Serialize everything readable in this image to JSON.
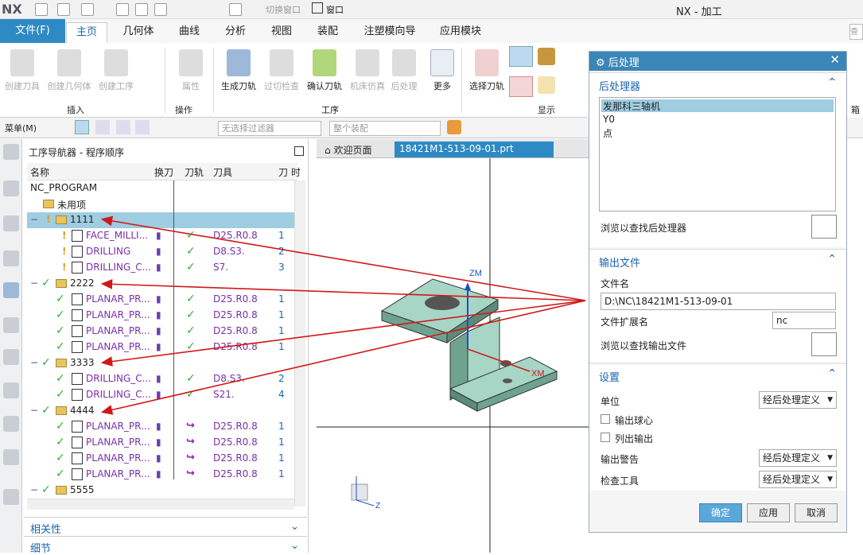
{
  "titlebar": {
    "logo": "NX",
    "title": "NX - 加工",
    "switch_window": "切换窗口",
    "window": "窗口"
  },
  "tabs": [
    "文件(F)",
    "主页",
    "几何体",
    "曲线",
    "分析",
    "视图",
    "装配",
    "注塑模向导",
    "应用模块"
  ],
  "search_hint": "查",
  "ribbon": {
    "buttons": [
      "创建刀具",
      "创建几何体",
      "创建工序",
      "属性",
      "生成刀轨",
      "过切检查",
      "确认刀轨",
      "机床仿真",
      "后处理",
      "更多",
      "选择刀轨"
    ],
    "groups": [
      "插入",
      "操作",
      "工序",
      "显示"
    ],
    "extra": "箱"
  },
  "toolbar": {
    "menu": "菜单(M)",
    "filter_placeholder": "无选择过滤器",
    "assembly_placeholder": "整个装配"
  },
  "navigator": {
    "title": "工序导航器 - 程序顺序",
    "headers": [
      "名称",
      "换刀",
      "刀轨",
      "刀具",
      "刀",
      "时"
    ],
    "root": "NC_PROGRAM",
    "unused": "未用项",
    "rows": [
      {
        "name": "1111",
        "type": "group",
        "tool": "",
        "num": ""
      },
      {
        "name": "FACE_MILLI...",
        "type": "op",
        "tool": "D25.R0.8",
        "num": "1"
      },
      {
        "name": "DRILLING",
        "type": "op",
        "tool": "D8.S3.",
        "num": "2"
      },
      {
        "name": "DRILLING_C...",
        "type": "op",
        "tool": "S7.",
        "num": "3"
      },
      {
        "name": "2222",
        "type": "group",
        "tool": "",
        "num": ""
      },
      {
        "name": "PLANAR_PR...",
        "type": "op",
        "tool": "D25.R0.8",
        "num": "1"
      },
      {
        "name": "PLANAR_PR...",
        "type": "op",
        "tool": "D25.R0.8",
        "num": "1"
      },
      {
        "name": "PLANAR_PR...",
        "type": "op",
        "tool": "D25.R0.8",
        "num": "1"
      },
      {
        "name": "PLANAR_PR...",
        "type": "op",
        "tool": "D25.R0.8",
        "num": "1"
      },
      {
        "name": "3333",
        "type": "group",
        "tool": "",
        "num": ""
      },
      {
        "name": "DRILLING_C...",
        "type": "op",
        "tool": "D8.S3.",
        "num": "2"
      },
      {
        "name": "DRILLING_C...",
        "type": "op",
        "tool": "S21.",
        "num": "4"
      },
      {
        "name": "4444",
        "type": "group",
        "tool": "",
        "num": ""
      },
      {
        "name": "PLANAR_PR...",
        "type": "op",
        "tool": "D25.R0.8",
        "num": "1"
      },
      {
        "name": "PLANAR_PR...",
        "type": "op",
        "tool": "D25.R0.8",
        "num": "1"
      },
      {
        "name": "PLANAR_PR...",
        "type": "op",
        "tool": "D25.R0.8",
        "num": "1"
      },
      {
        "name": "PLANAR_PR...",
        "type": "op",
        "tool": "D25.R0.8",
        "num": "1"
      },
      {
        "name": "5555",
        "type": "group",
        "tool": "",
        "num": ""
      }
    ],
    "sections": [
      "相关性",
      "细节"
    ]
  },
  "viewport": {
    "tabs": [
      "欢迎页面",
      "18421M1-513-09-01.prt"
    ],
    "axis_zm": "ZM",
    "axis_xm": "XM",
    "axis_z": "Z"
  },
  "dialog": {
    "title": "后处理",
    "sec_post": "后处理器",
    "postprocessors": [
      "发那科三轴机",
      "Y0",
      "点"
    ],
    "browse_post": "浏览以查找后处理器",
    "sec_output": "输出文件",
    "filename_label": "文件名",
    "filename": "D:\\NC\\18421M1-513-09-01",
    "ext_label": "文件扩展名",
    "ext": "nc",
    "browse_output": "浏览以查找输出文件",
    "sec_settings": "设置",
    "unit_label": "单位",
    "unit_value": "经后处理定义",
    "out_ball": "输出球心",
    "list_output": "列出输出",
    "warn_label": "输出警告",
    "warn_value": "经后处理定义",
    "check_label": "检查工具",
    "check_value": "经后处理定义",
    "ok": "确定",
    "apply": "应用",
    "cancel": "取消"
  },
  "colors": {
    "accent": "#2d8ac4",
    "selection": "#9fcde2",
    "annotation": "#d01818",
    "part": "#6fa38f"
  }
}
